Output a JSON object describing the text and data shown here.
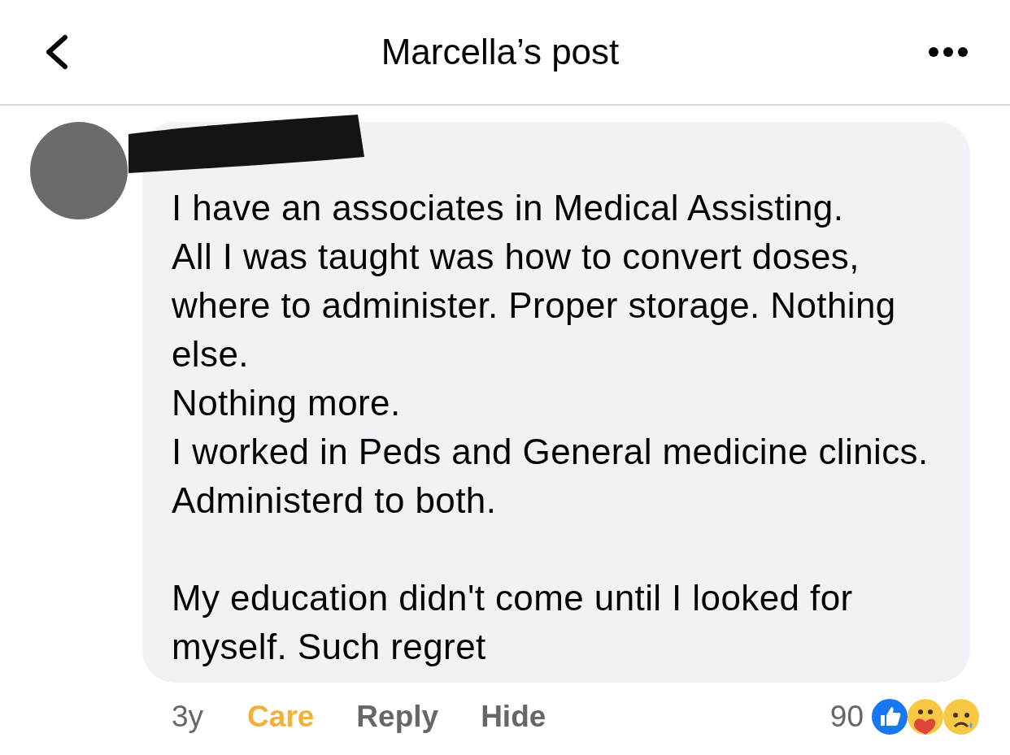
{
  "header": {
    "title": "Marcella’s post"
  },
  "comment": {
    "paragraphs": [
      [
        "I have an associates in Medical Assisting.",
        "All I was taught was how to convert doses, where to administer. Proper storage. Nothing else.",
        "Nothing more.",
        "I worked in Peds and General medicine clinics.",
        "Administerd to both."
      ],
      [
        "My education didn't come until I looked for myself. Such regret"
      ]
    ],
    "time": "3y",
    "reaction": {
      "label": "Care",
      "selected": true
    },
    "actions": [
      "Reply",
      "Hide"
    ],
    "reaction_count": "90"
  }
}
